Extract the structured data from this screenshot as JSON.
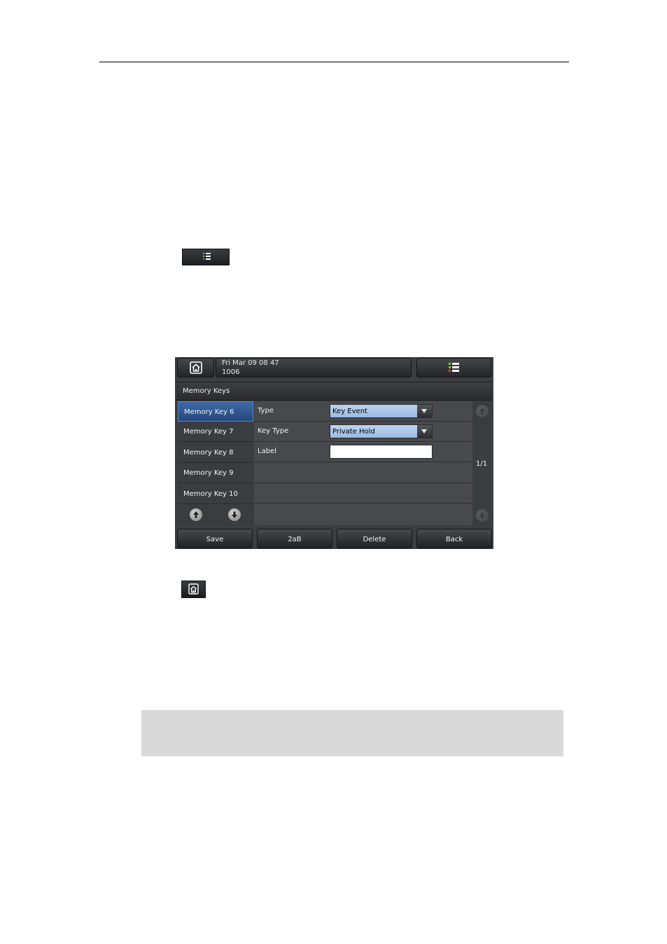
{
  "icons": {
    "menu": "list-menu-icon",
    "home": "home-icon",
    "up": "arrow-up-icon",
    "down": "arrow-down-icon",
    "dropdown": "triangle-down-icon"
  },
  "colors": {
    "selected_item": "#2f5690",
    "combo_fill": "#aac6e8",
    "menu_bullet_green": "#7ec143",
    "menu_bullet_red": "#d44b3c",
    "note_box": "#d9d9d9"
  },
  "phone": {
    "status": {
      "datetime": "Fri Mar 09 08 47",
      "account": "1006"
    },
    "title": "Memory Keys",
    "left_items": [
      {
        "label": "Memory Key 6",
        "selected": true
      },
      {
        "label": "Memory Key 7",
        "selected": false
      },
      {
        "label": "Memory Key 8",
        "selected": false
      },
      {
        "label": "Memory Key 9",
        "selected": false
      },
      {
        "label": "Memory Key 10",
        "selected": false
      }
    ],
    "fields": {
      "type": {
        "label": "Type",
        "value": "Key Event"
      },
      "key_type": {
        "label": "Key Type",
        "value": "Private Hold"
      },
      "label": {
        "label": "Label",
        "value": ""
      }
    },
    "page_indicator": "1/1",
    "softkeys": [
      "Save",
      "2aB",
      "Delete",
      "Back"
    ]
  }
}
